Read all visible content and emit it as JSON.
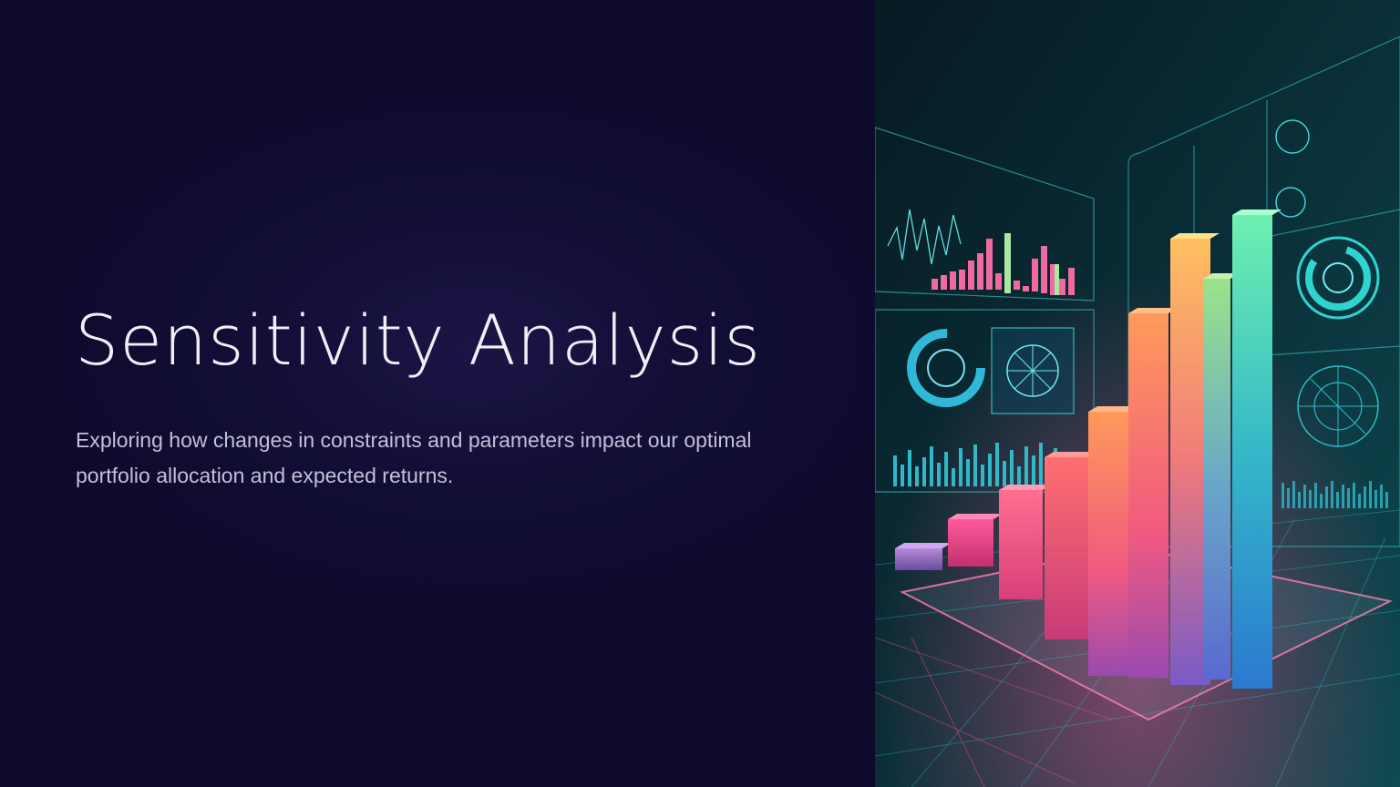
{
  "slide": {
    "title": "Sensitivity Analysis",
    "subtitle": "Exploring how changes in constraints and parameters impact our optimal portfolio allocation and expected returns."
  },
  "hero_image": {
    "icon": "3d-bar-chart-dashboard-illustration"
  },
  "colors": {
    "background": "#0d0a2b",
    "title": "#f1eef8",
    "subtitle": "#c3c0d9",
    "accent_cyan": "#2fd3d0",
    "accent_pink": "#f0508c",
    "accent_orange": "#f7a44a"
  }
}
